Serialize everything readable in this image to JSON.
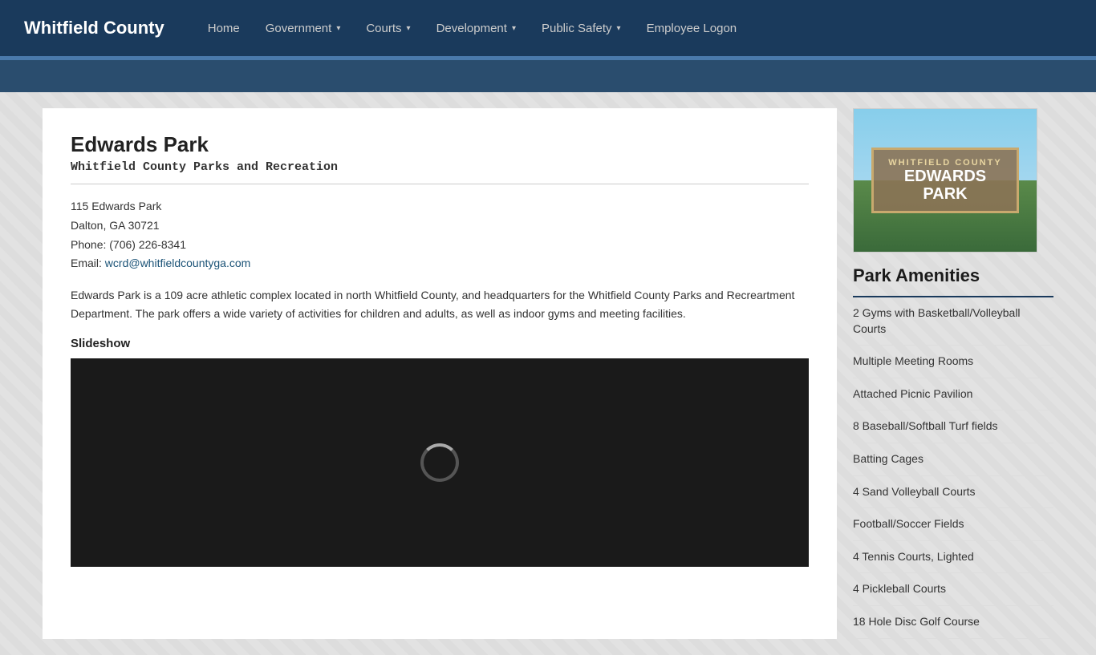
{
  "nav": {
    "brand": "Whitfield County",
    "links": [
      {
        "label": "Home",
        "has_caret": false
      },
      {
        "label": "Government",
        "has_caret": true
      },
      {
        "label": "Courts",
        "has_caret": true
      },
      {
        "label": "Development",
        "has_caret": true
      },
      {
        "label": "Public Safety",
        "has_caret": true
      },
      {
        "label": "Employee Logon",
        "has_caret": false
      }
    ]
  },
  "page": {
    "title": "Edwards Park",
    "subtitle": "Whitfield County Parks and Recreation",
    "address_line1": "115 Edwards Park",
    "address_line2": "Dalton, GA 30721",
    "phone_label": "Phone:",
    "phone_value": "(706) 226-8341",
    "email_label": "Email:",
    "email_value": "wcrd@whitfieldcountyga.com",
    "description": "Edwards Park is a 109 acre athletic complex located in north Whitfield County, and headquarters for the Whitfield County Parks and Recreartment Department. The park offers a wide variety of activities for children and adults, as well as indoor gyms and meeting facilities.",
    "slideshow_label": "Slideshow"
  },
  "sidebar": {
    "park_sign": {
      "county_text": "WHITFIELD COUNTY",
      "park_name_line1": "EDWARDS",
      "park_name_line2": "PARK"
    },
    "amenities_title": "Park Amenities",
    "amenities": [
      "2 Gyms with Basketball/Volleyball Courts",
      "Multiple Meeting Rooms",
      "Attached Picnic Pavilion",
      "8 Baseball/Softball Turf fields",
      "Batting Cages",
      "4 Sand Volleyball Courts",
      "Football/Soccer Fields",
      "4 Tennis Courts, Lighted",
      "4 Pickleball Courts",
      "18 Hole Disc Golf Course"
    ]
  }
}
